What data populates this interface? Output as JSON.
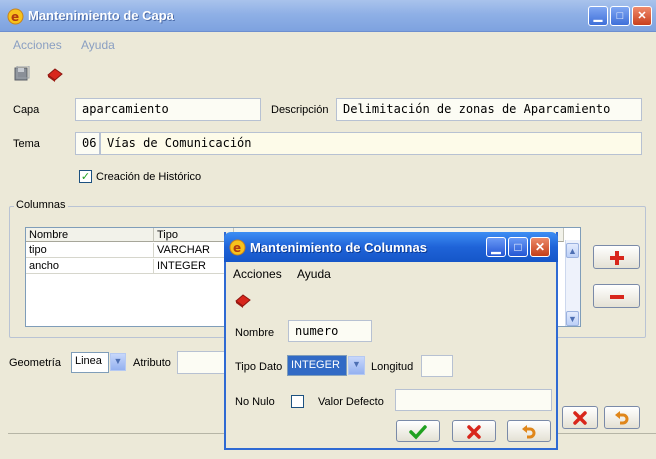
{
  "window": {
    "title": "Mantenimiento de Capa"
  },
  "menu": [
    "Acciones",
    "Ayuda"
  ],
  "form": {
    "capa_label": "Capa",
    "capa_value": "aparcamiento",
    "descripcion_label": "Descripción",
    "descripcion_value": "Delimitación de zonas de Aparcamiento",
    "tema_label": "Tema",
    "tema_code": "06",
    "tema_value": "Vías de Comunicación",
    "historico_label": "Creación de Histórico",
    "historico_checked": true
  },
  "columnas": {
    "group_label": "Columnas",
    "headers": [
      "Nombre",
      "Tipo"
    ],
    "rows": [
      [
        "tipo",
        "VARCHAR"
      ],
      [
        "ancho",
        "INTEGER"
      ]
    ]
  },
  "geometria": {
    "label": "Geometría",
    "value": "Linea",
    "atributo_label": "Atributo"
  },
  "dialog": {
    "title": "Mantenimiento de Columnas",
    "menu": [
      "Acciones",
      "Ayuda"
    ],
    "nombre_label": "Nombre",
    "nombre_value": "numero",
    "tipo_label": "Tipo Dato",
    "tipo_value": "INTEGER",
    "longitud_label": "Longitud",
    "longitud_value": "",
    "nonulo_label": "No Nulo",
    "nonulo_checked": false,
    "defecto_label": "Valor Defecto",
    "defecto_value": ""
  },
  "colors": {
    "accent": "#2f6ad3",
    "title_inactive": "#8fb0e6",
    "add": "#d8261c",
    "ok": "#21a121"
  }
}
